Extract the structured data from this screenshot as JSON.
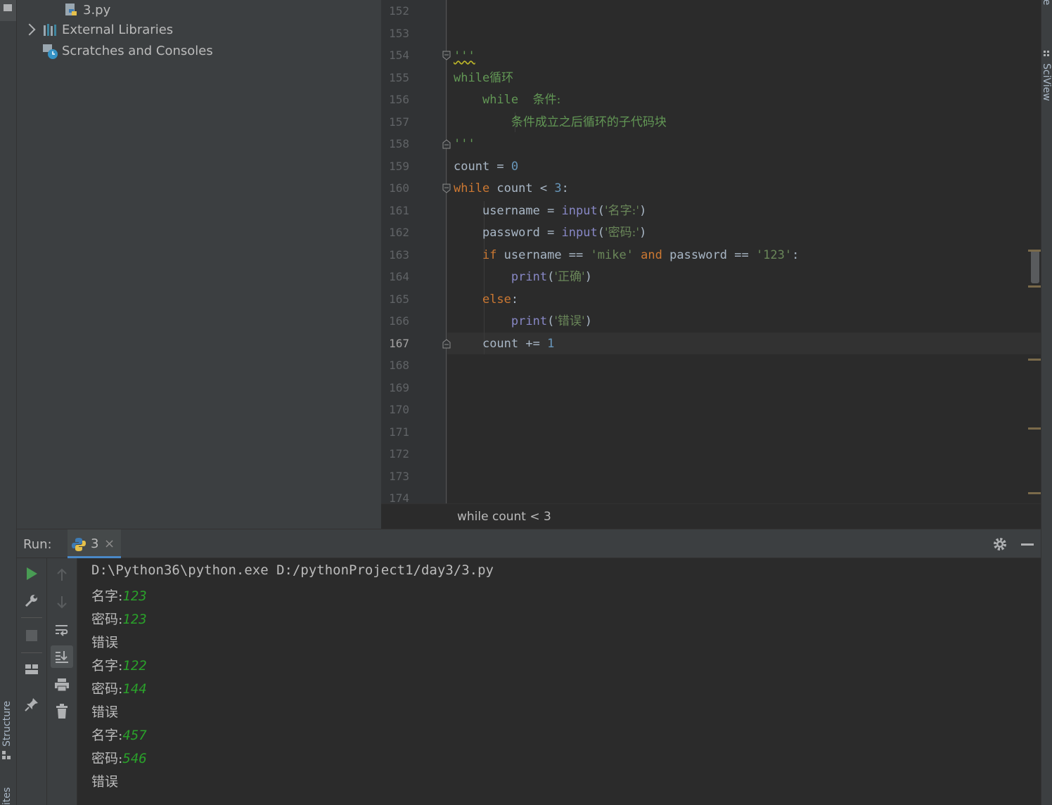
{
  "left_stripe": {
    "structure_label": "Structure",
    "favorites_label": "ites"
  },
  "right_stripe": {
    "database_label": "base",
    "sciview_label": "SciView"
  },
  "project_tree": {
    "items": [
      {
        "label": "3.py",
        "icon": "python-file-icon"
      },
      {
        "label": "External Libraries",
        "icon": "libraries-icon"
      },
      {
        "label": "Scratches and Consoles",
        "icon": "scratches-icon"
      }
    ]
  },
  "editor": {
    "line_numbers": [
      "152",
      "153",
      "154",
      "155",
      "156",
      "157",
      "158",
      "159",
      "160",
      "161",
      "162",
      "163",
      "164",
      "165",
      "166",
      "167",
      "168",
      "169",
      "170",
      "171",
      "172",
      "173",
      "174"
    ],
    "current_line": "167",
    "breadcrumb": "while count < 3",
    "code": {
      "l154": "'''",
      "l155": "while循环",
      "l156_a": "while",
      "l156_b": "条件:",
      "l157": "条件成立之后循环的子代码块",
      "l158": "'''",
      "l159_var": "count",
      "l159_op": " = ",
      "l159_num": "0",
      "l160_kw": "while",
      "l160_rest": " count < ",
      "l160_num": "3",
      "l160_end": ":",
      "l161_var": "username = ",
      "l161_fn": "input",
      "l161_p1": "(",
      "l161_str": "'名字:'",
      "l161_p2": ")",
      "l162_var": "password = ",
      "l162_fn": "input",
      "l162_p1": "(",
      "l162_str": "'密码:'",
      "l162_p2": ")",
      "l163_if": "if",
      "l163_a": " username == ",
      "l163_s1": "'mike'",
      "l163_and": " and",
      "l163_b": " password == ",
      "l163_s2": "'123'",
      "l163_c": ":",
      "l164_fn": "print",
      "l164_p1": "(",
      "l164_str": "'正确'",
      "l164_p2": ")",
      "l165_kw": "else",
      "l165_c": ":",
      "l166_fn": "print",
      "l166_p1": "(",
      "l166_str": "'错误'",
      "l166_p2": ")",
      "l167_var": "count += ",
      "l167_num": "1"
    }
  },
  "run_panel": {
    "label": "Run:",
    "tab_label": "3",
    "tab_close": "×",
    "console_lines": [
      {
        "prompt": "D:\\Python36\\python.exe D:/pythonProject1/day3/3.py",
        "input": ""
      },
      {
        "prompt": "名字:",
        "input": "123"
      },
      {
        "prompt": "密码:",
        "input": "123"
      },
      {
        "prompt": "错误",
        "input": ""
      },
      {
        "prompt": "名字:",
        "input": "122"
      },
      {
        "prompt": "密码:",
        "input": "144"
      },
      {
        "prompt": "错误",
        "input": ""
      },
      {
        "prompt": "名字:",
        "input": "457"
      },
      {
        "prompt": "密码:",
        "input": "546"
      },
      {
        "prompt": "错误",
        "input": ""
      }
    ]
  },
  "colors": {
    "keyword": "#cc7832",
    "number": "#6897bb",
    "string": "#6a8759",
    "builtin": "#8888c6",
    "docstring": "#629755",
    "console_input": "#2aa12a",
    "run_button": "#499c54"
  }
}
